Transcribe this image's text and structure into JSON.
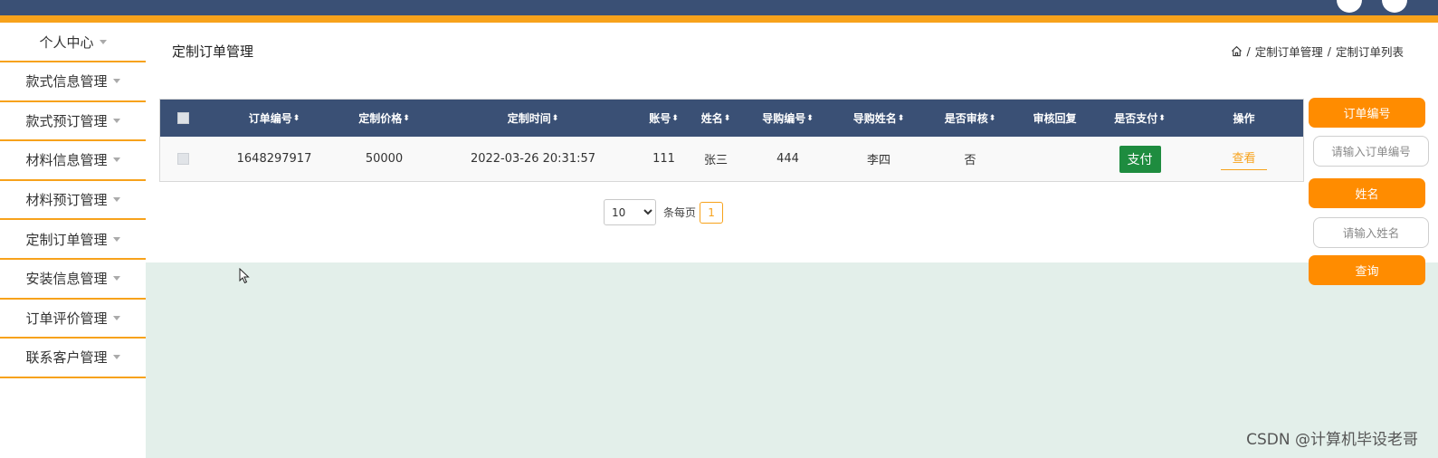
{
  "sidebar": {
    "items": [
      {
        "label": "个人中心"
      },
      {
        "label": "款式信息管理"
      },
      {
        "label": "款式预订管理"
      },
      {
        "label": "材料信息管理"
      },
      {
        "label": "材料预订管理"
      },
      {
        "label": "定制订单管理"
      },
      {
        "label": "安装信息管理"
      },
      {
        "label": "订单评价管理"
      },
      {
        "label": "联系客户管理"
      }
    ]
  },
  "header": {
    "title": "定制订单管理",
    "breadcrumb": [
      "定制订单管理",
      "定制订单列表"
    ],
    "separator": "/"
  },
  "table": {
    "columns": [
      "订单编号",
      "定制价格",
      "定制时间",
      "账号",
      "姓名",
      "导购编号",
      "导购姓名",
      "是否审核",
      "审核回复",
      "是否支付",
      "操作"
    ],
    "sort_symbol": "⬍",
    "rows": [
      {
        "order_no": "1648297917",
        "price": "50000",
        "time": "2022-03-26 20:31:57",
        "account": "111",
        "name": "张三",
        "guide_no": "444",
        "guide_name": "李四",
        "audited": "否",
        "reply": "",
        "pay_label": "支付",
        "action_label": "查看"
      }
    ]
  },
  "pagination": {
    "page_size": "10",
    "per_page_label": "条每页",
    "current_page": "1"
  },
  "filters": {
    "order_no_label": "订单编号",
    "order_no_placeholder": "请输入订单编号",
    "name_label": "姓名",
    "name_placeholder": "请输入姓名",
    "search_label": "查询"
  },
  "watermark": "CSDN @计算机毕设老哥",
  "colors": {
    "primary_dark": "#3a5075",
    "accent_orange": "#f7a21b",
    "button_orange": "#ff8c00",
    "pay_green": "#1e8c3f",
    "content_bg": "#e3efea"
  }
}
